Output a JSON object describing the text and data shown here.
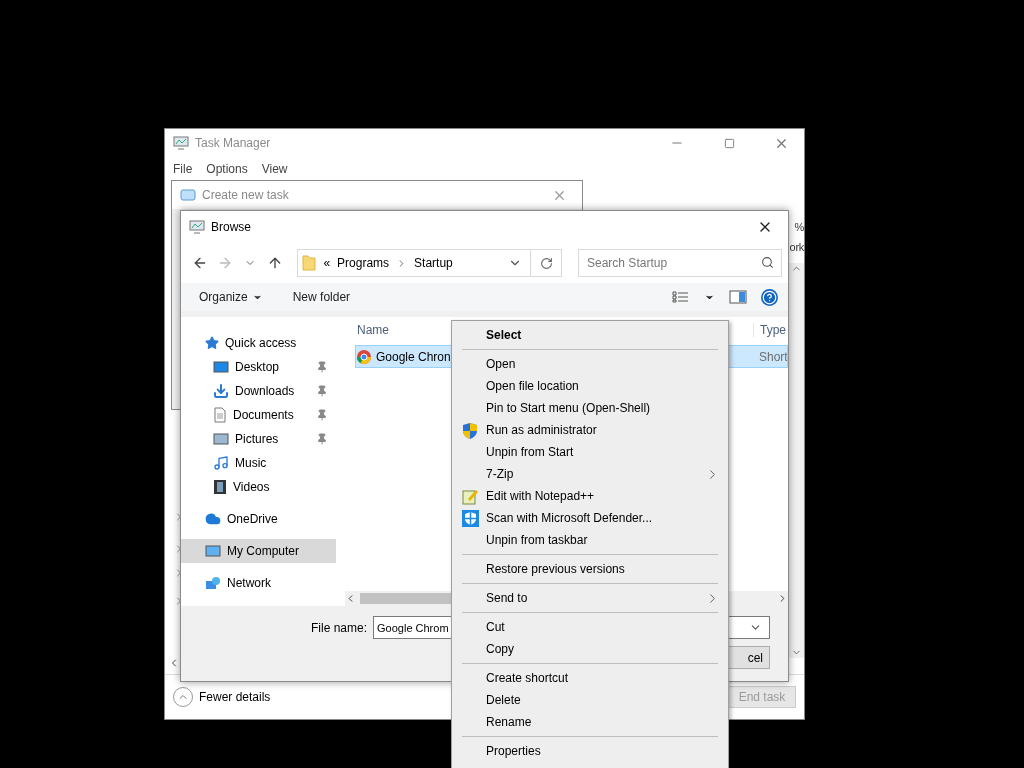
{
  "task_manager": {
    "title": "Task Manager",
    "menu": [
      "File",
      "Options",
      "View"
    ],
    "peek_texts": [
      "%",
      "ork"
    ],
    "fewer_details": "Fewer details",
    "end_task": {
      "label": "End task",
      "disabled": true
    }
  },
  "create_task": {
    "title": "Create new task"
  },
  "browse": {
    "title": "Browse",
    "address": {
      "overflow": "«",
      "crumbs": [
        "Programs",
        "Startup"
      ]
    },
    "search": {
      "placeholder": "Search Startup"
    },
    "toolbar": {
      "organize": "Organize",
      "new_folder": "New folder"
    },
    "nav": [
      {
        "label": "Quick access",
        "selected": false,
        "children": [
          {
            "label": "Desktop",
            "pinned": true,
            "selected": false
          },
          {
            "label": "Downloads",
            "pinned": true,
            "selected": false
          },
          {
            "label": "Documents",
            "pinned": true,
            "selected": false
          },
          {
            "label": "Pictures",
            "pinned": true,
            "selected": false
          },
          {
            "label": "Music",
            "pinned": false,
            "selected": false
          },
          {
            "label": "Videos",
            "pinned": false,
            "selected": false
          }
        ]
      },
      {
        "label": "OneDrive",
        "selected": false
      },
      {
        "label": "My Computer",
        "selected": true
      },
      {
        "label": "Network",
        "selected": false
      }
    ],
    "columns": [
      "Name",
      "Type"
    ],
    "files": [
      {
        "name": "Google Chron",
        "type": "Short",
        "selected": true
      }
    ],
    "file_name": {
      "label": "File name:",
      "value": "Google Chrom"
    },
    "cancel": "cel"
  },
  "context_menu": [
    {
      "kind": "default",
      "label": "Select"
    },
    {
      "kind": "separator"
    },
    {
      "kind": "item",
      "label": "Open"
    },
    {
      "kind": "item",
      "label": "Open file location"
    },
    {
      "kind": "item",
      "label": "Pin to Start menu (Open-Shell)"
    },
    {
      "kind": "item",
      "label": "Run as administrator"
    },
    {
      "kind": "item",
      "label": "Unpin from Start"
    },
    {
      "kind": "submenu",
      "label": "7-Zip"
    },
    {
      "kind": "item",
      "label": "Edit with Notepad++"
    },
    {
      "kind": "item",
      "label": "Scan with Microsoft Defender..."
    },
    {
      "kind": "item",
      "label": "Unpin from taskbar"
    },
    {
      "kind": "separator"
    },
    {
      "kind": "item",
      "label": "Restore previous versions"
    },
    {
      "kind": "separator"
    },
    {
      "kind": "submenu",
      "label": "Send to"
    },
    {
      "kind": "separator"
    },
    {
      "kind": "item",
      "label": "Cut"
    },
    {
      "kind": "item",
      "label": "Copy"
    },
    {
      "kind": "separator"
    },
    {
      "kind": "item",
      "label": "Create shortcut"
    },
    {
      "kind": "item",
      "label": "Delete"
    },
    {
      "kind": "item",
      "label": "Rename"
    },
    {
      "kind": "separator"
    },
    {
      "kind": "item",
      "label": "Properties"
    }
  ]
}
